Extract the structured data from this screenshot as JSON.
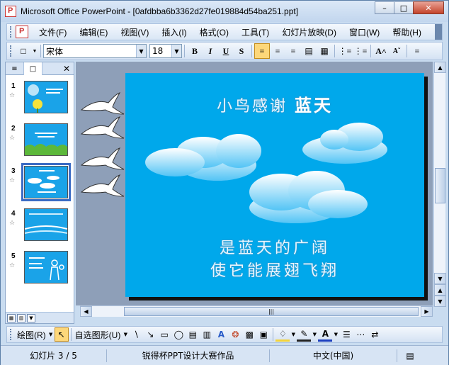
{
  "window": {
    "title": "Microsoft Office PowerPoint - [0afdbba6b3362d27fe019884d54ba251.ppt]",
    "controls": {
      "minimize": "–",
      "restore": "□",
      "close": "✕"
    }
  },
  "menubar": {
    "items": [
      "文件(F)",
      "编辑(E)",
      "视图(V)",
      "插入(I)",
      "格式(O)",
      "工具(T)",
      "幻灯片放映(D)",
      "窗口(W)",
      "帮助(H)"
    ]
  },
  "toolbar": {
    "font_name": "宋体",
    "font_size": "18",
    "bold": "B",
    "italic": "I",
    "underline": "U",
    "shadow": "S",
    "grow": "A˄"
  },
  "outline_panel": {
    "slides": [
      {
        "number": "1",
        "star": "☆"
      },
      {
        "number": "2",
        "star": "☆"
      },
      {
        "number": "3",
        "star": "☆"
      },
      {
        "number": "4",
        "star": "☆"
      },
      {
        "number": "5",
        "star": "☆"
      }
    ],
    "selected": 3
  },
  "slide": {
    "title_part1": "小鸟感谢",
    "title_part2": "蓝天",
    "body_line1": "是蓝天的广阔",
    "body_line2": "使它能展翅飞翔",
    "background_color": "#00a8eb"
  },
  "draw_toolbar": {
    "draw_label": "绘图(R)",
    "autoshapes_label": "自选图形(U)"
  },
  "statusbar": {
    "slide_position": "幻灯片 3 / 5",
    "design": "锐得杯PPT设计大赛作品",
    "language": "中文(中国)"
  }
}
